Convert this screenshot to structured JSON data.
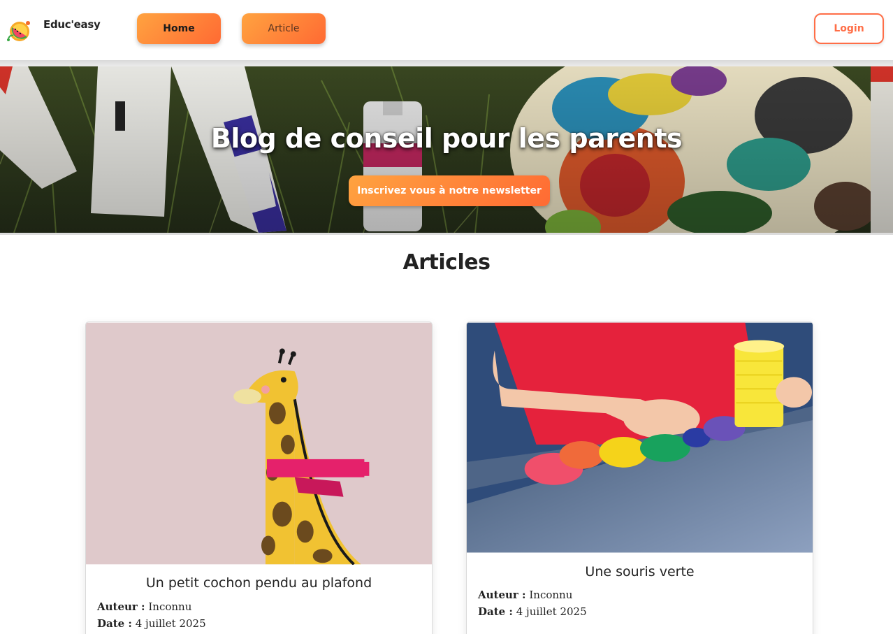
{
  "nav": {
    "brand": "Educ'easy",
    "home_label": "Home",
    "article_label": "Article",
    "login_label": "Login",
    "accent_gradient": [
      "#ffa340",
      "#ff6a33"
    ],
    "login_color": "#ff6e47"
  },
  "hero": {
    "title": "Blog de conseil pour les parents",
    "newsletter_label": "Inscrivez vous à notre newsletter"
  },
  "articles": {
    "heading": "Articles",
    "items": [
      {
        "title": "Un petit cochon pendu au plafond",
        "author_label": "Auteur :",
        "author": "Inconnu",
        "date_label": "Date :",
        "date": "4 juillet 2025",
        "image": "giraffe-with-scarf-illustration"
      },
      {
        "title": "Une souris verte",
        "author_label": "Auteur :",
        "author": "Inconnu",
        "date_label": "Date :",
        "date": "4 juillet 2025",
        "image": "child-playing-with-modeling-clay"
      }
    ]
  }
}
